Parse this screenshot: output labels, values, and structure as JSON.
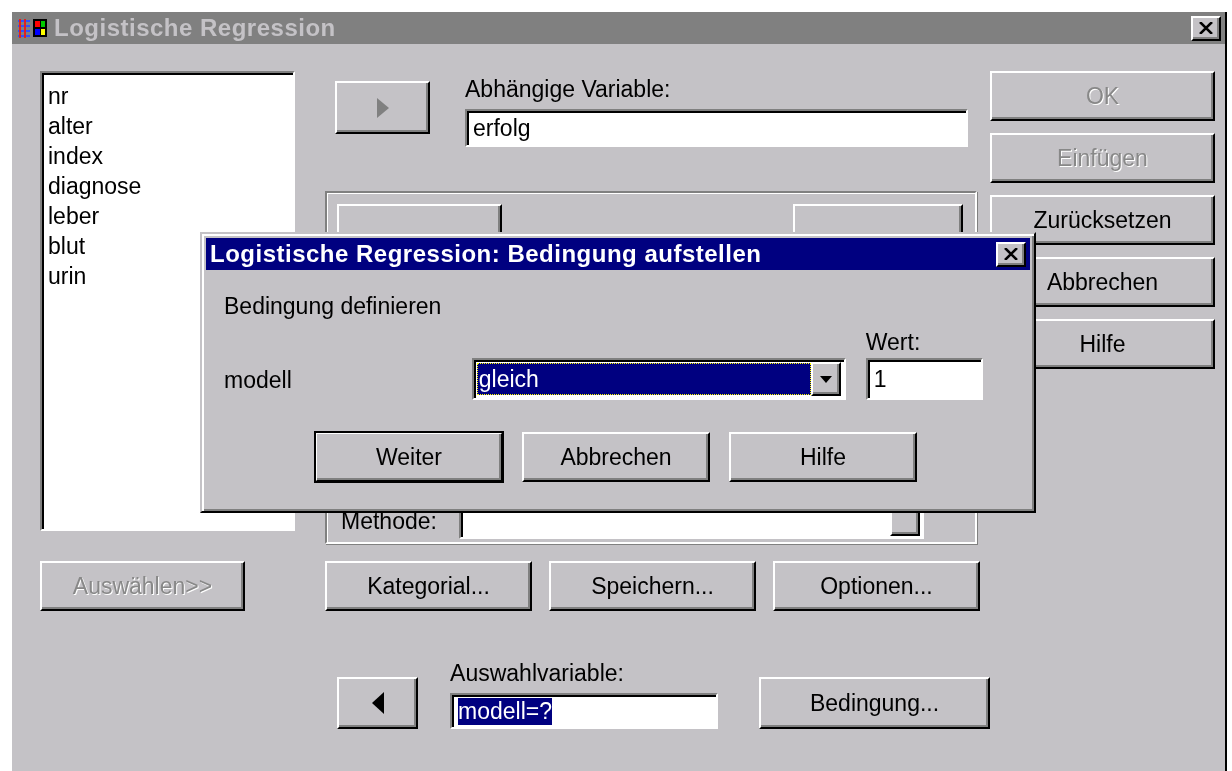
{
  "window": {
    "title": "Logistische Regression",
    "active": false
  },
  "variables": [
    "nr",
    "alter",
    "index",
    "diagnose",
    "leber",
    "blut",
    "urin"
  ],
  "select_button": {
    "label": "Auswählen>>",
    "disabled": true
  },
  "dependent": {
    "move_disabled": true,
    "label": "Abhängige Variable:",
    "value": "erfolg"
  },
  "block": {
    "method_label": "Methode:"
  },
  "option_buttons": [
    {
      "label": "Kategorial...",
      "disabled": false
    },
    {
      "label": "Speichern...",
      "disabled": false
    },
    {
      "label": "Optionen...",
      "disabled": false
    }
  ],
  "selection": {
    "label": "Auswahlvariable:",
    "value": "modell=?",
    "selected": true,
    "condition_button": "Bedingung..."
  },
  "side_buttons": [
    {
      "label": "OK",
      "disabled": true
    },
    {
      "label": "Einfügen",
      "disabled": true
    },
    {
      "label": "Zurücksetzen",
      "disabled": false
    },
    {
      "label": "Abbrechen",
      "disabled": false
    },
    {
      "label": "Hilfe",
      "disabled": false
    }
  ],
  "condition_dialog": {
    "title": "Logistische Regression: Bedingung aufstellen",
    "active": true,
    "heading": "Bedingung definieren",
    "variable": "modell",
    "operator": {
      "value": "gleich",
      "selected": true
    },
    "value_label": "Wert:",
    "value": "1",
    "buttons": [
      {
        "label": "Weiter",
        "default": true
      },
      {
        "label": "Abbrechen",
        "default": false
      },
      {
        "label": "Hilfe",
        "default": false
      }
    ]
  }
}
